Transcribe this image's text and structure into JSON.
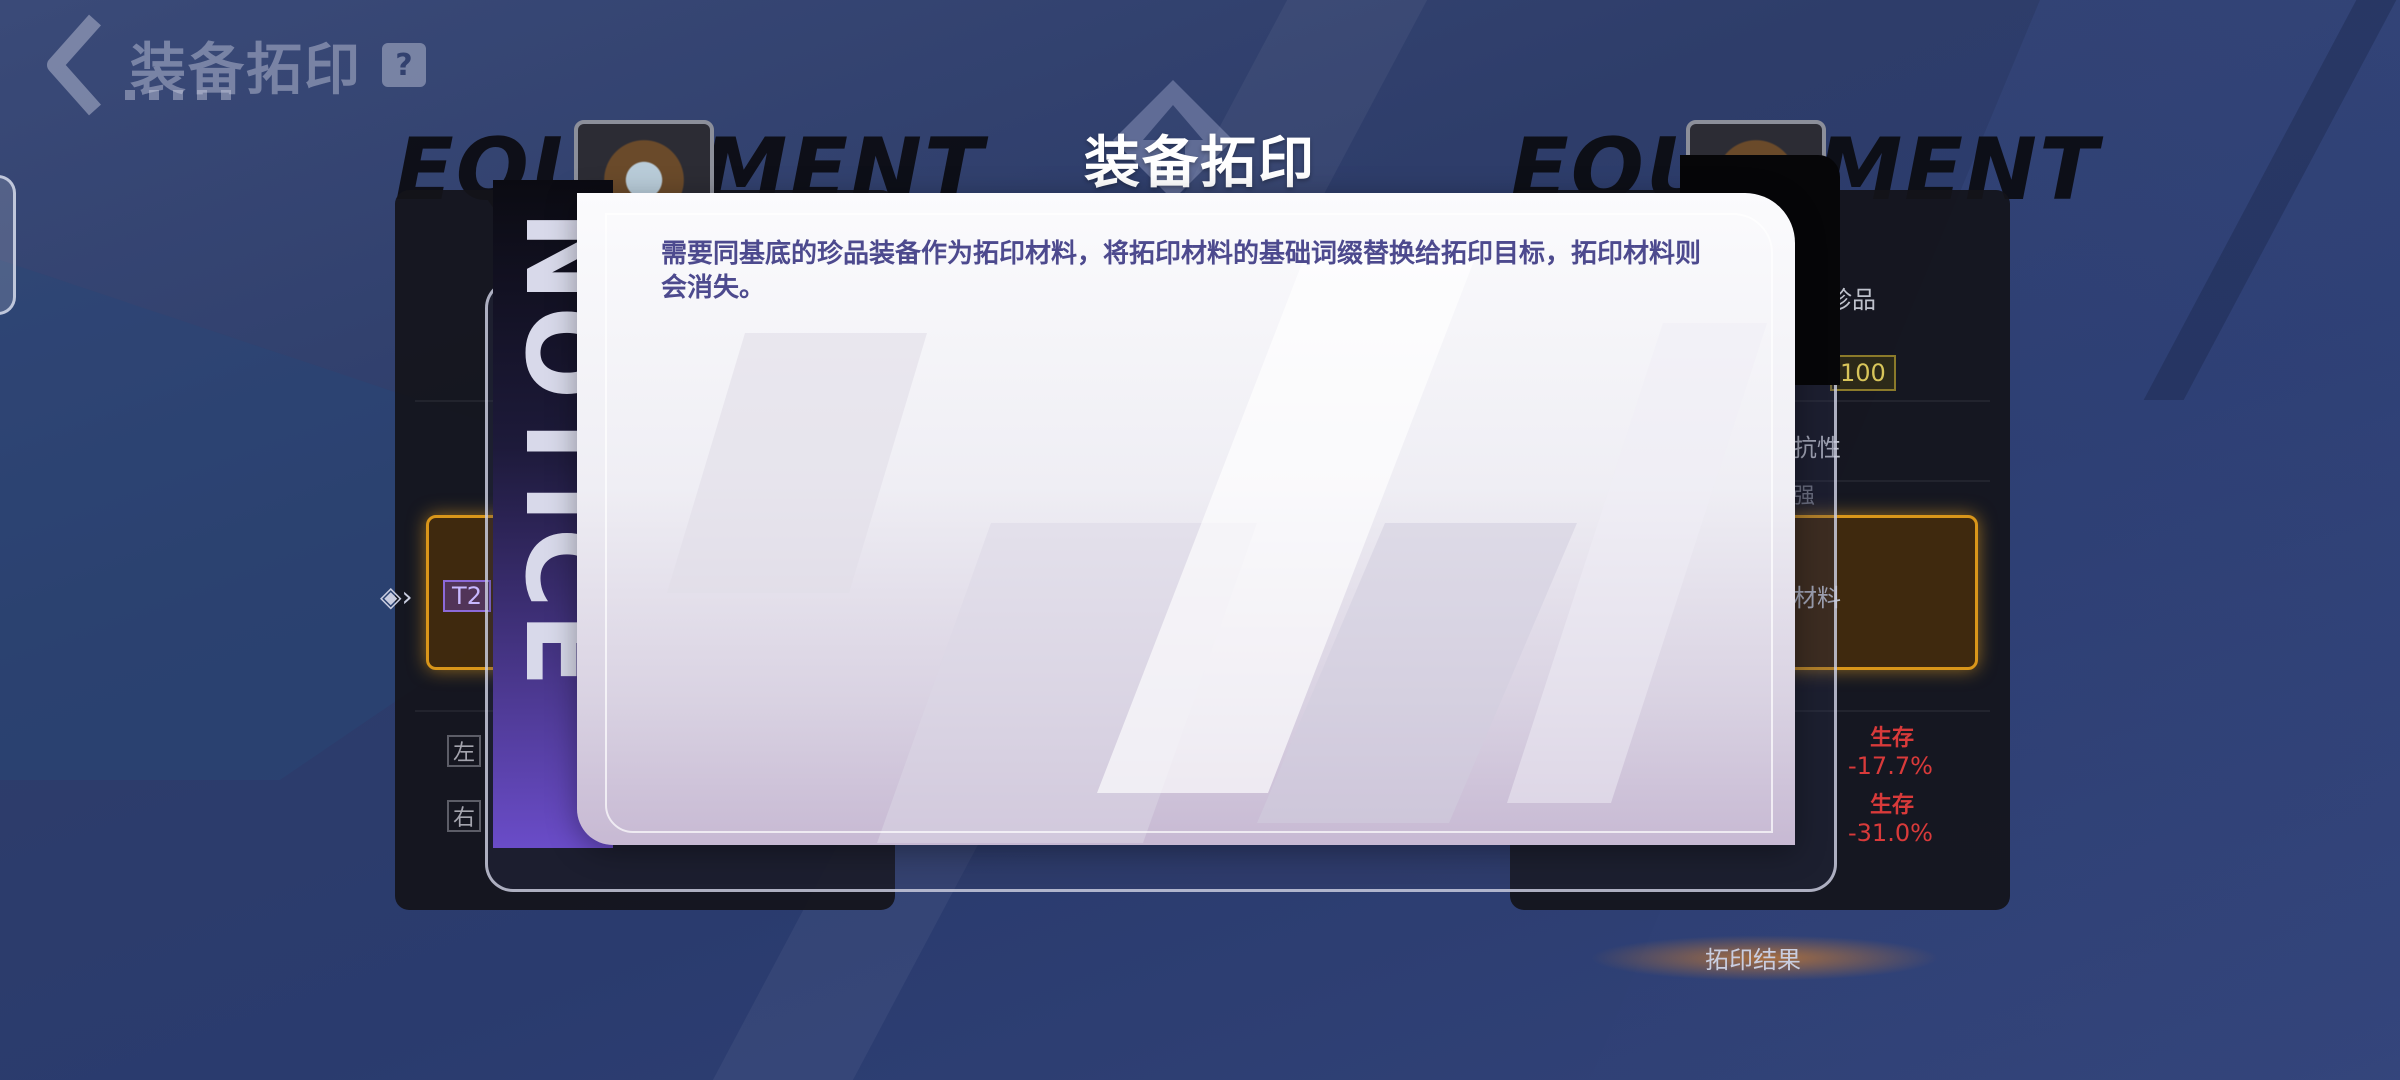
{
  "header": {
    "title": "装备拓印",
    "help_label": "?"
  },
  "panel_word": "EQUIPMENT",
  "left_panel": {
    "tier_badge": "T2",
    "left_label": "左",
    "right_label": "右"
  },
  "right_panel": {
    "rarity": "珍品",
    "value": "100",
    "attribute": "抗性",
    "sub_text": "强",
    "material_label": "材料",
    "stats": [
      {
        "label": "生存",
        "value": "-17.7%"
      },
      {
        "label": "生存",
        "value": "-31.0%"
      }
    ],
    "result_label": "拓印结果"
  },
  "modal": {
    "side_word": "NOTICE",
    "title": "装备拓印",
    "body": "需要同基底的珍品装备作为拓印材料，将拓印材料的基础词缀替换给拓印目标，拓印材料则会消失。"
  },
  "colors": {
    "accent_orange": "#d9961a",
    "stat_red": "#d93a3a",
    "modal_text": "#4d4a8e"
  }
}
